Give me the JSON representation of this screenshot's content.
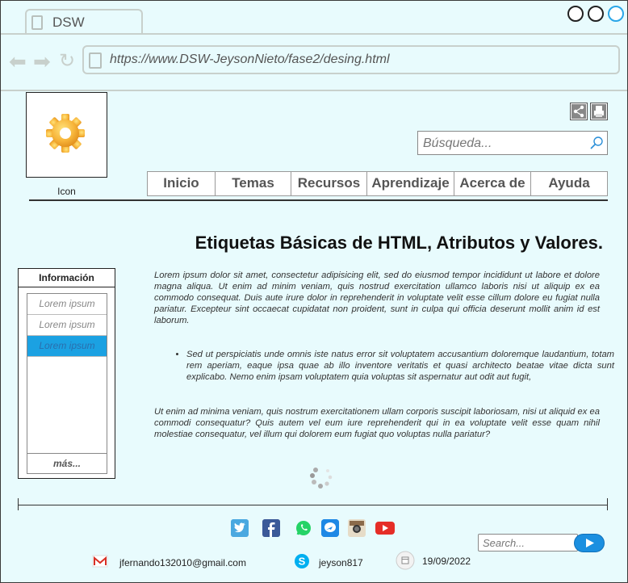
{
  "browser": {
    "tab_title": "DSW",
    "url": "https://www.DSW-JeysonNieto/fase2/desing.html"
  },
  "header": {
    "logo_label": "Icon",
    "search_placeholder": "Búsqueda...",
    "menu": [
      "Inicio",
      "Temas",
      "Recursos",
      "Aprendizaje",
      "Acerca de",
      "Ayuda"
    ]
  },
  "main": {
    "title": "Etiquetas Básicas de HTML, Atributos y Valores.",
    "paragraph1": "Lorem ipsum dolor sit amet, consectetur adipisicing elit, sed do eiusmod tempor incididunt ut labore et dolore magna aliqua. Ut enim ad minim veniam, quis nostrud exercitation ullamco laboris nisi ut aliquip ex ea commodo consequat. Duis aute irure dolor in reprehenderit in voluptate velit esse cillum dolore eu fugiat nulla pariatur. Excepteur sint occaecat cupidatat non proident, sunt in culpa qui officia deserunt mollit anim id est laborum.",
    "bullet1": "Sed ut perspiciatis unde omnis iste natus error sit voluptatem accusantium doloremque laudantium, totam rem aperiam, eaque ipsa quae ab illo inventore veritatis et quasi architecto beatae vitae dicta sunt explicabo. Nemo enim ipsam voluptatem quia voluptas sit aspernatur aut odit aut fugit,",
    "paragraph2": "Ut enim ad minima veniam, quis nostrum exercitationem ullam corporis suscipit laboriosam, nisi ut aliquid ex ea commodi consequatur? Quis autem vel eum iure reprehenderit qui in ea voluptate velit esse quam nihil molestiae consequatur, vel illum qui dolorem eum fugiat quo voluptas nulla pariatur?"
  },
  "info_panel": {
    "header": "Información",
    "items": [
      "Lorem ipsum",
      "Lorem ipsum",
      "Lorem ipsum"
    ],
    "active_index": 2,
    "more": "más..."
  },
  "footer": {
    "social_icons": [
      "twitter-icon",
      "facebook-icon",
      "whatsapp-icon",
      "messenger-icon",
      "instagram-icon",
      "youtube-icon"
    ],
    "search_placeholder": "Search...",
    "email": "jfernando132010@gmail.com",
    "skype": "jeyson817",
    "date": "19/09/2022"
  },
  "colors": {
    "background": "#e8fbfd",
    "accent": "#1ba1e2"
  }
}
